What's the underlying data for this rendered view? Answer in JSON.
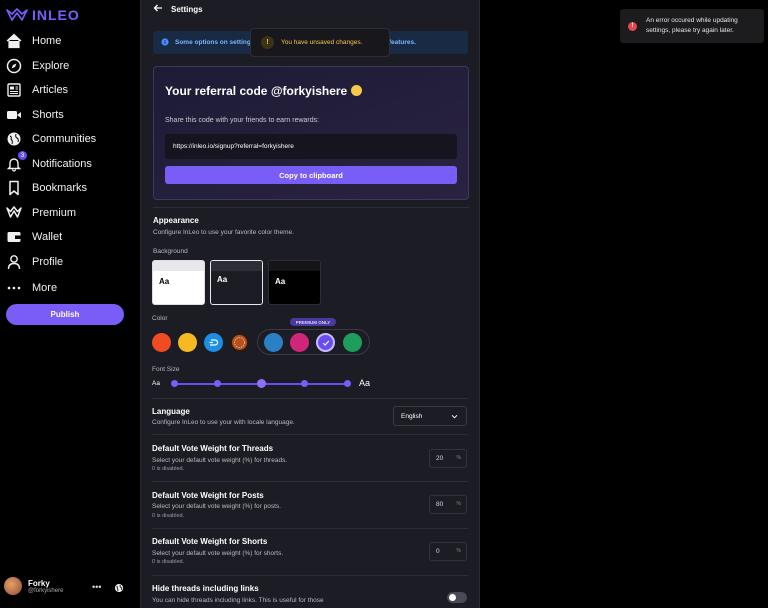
{
  "app": {
    "logo_text": "INLEO",
    "brand_color": "#7a5cf6"
  },
  "sidebar": {
    "items": [
      {
        "label": "Home",
        "icon": "home-icon"
      },
      {
        "label": "Explore",
        "icon": "compass-icon"
      },
      {
        "label": "Articles",
        "icon": "newspaper-icon"
      },
      {
        "label": "Shorts",
        "icon": "video-icon"
      },
      {
        "label": "Communities",
        "icon": "globe-icon"
      },
      {
        "label": "Notifications",
        "icon": "bell-icon",
        "badge": "3"
      },
      {
        "label": "Bookmarks",
        "icon": "bookmark-icon"
      },
      {
        "label": "Premium",
        "icon": "leo-logo-icon"
      },
      {
        "label": "Wallet",
        "icon": "wallet-icon"
      },
      {
        "label": "Profile",
        "icon": "user-icon"
      },
      {
        "label": "More",
        "icon": "more-dots-icon"
      }
    ],
    "publish_label": "Publish",
    "user": {
      "name": "Forky",
      "handle": "@forkyishere"
    }
  },
  "header": {
    "title": "Settings"
  },
  "info_banner": {
    "text": "Some options on settings are in development and we are developing features."
  },
  "toast_unsaved": {
    "text": "You have unsaved changes."
  },
  "toast_error": {
    "line1": "An error occured while updating",
    "line2": "settings, please try again later."
  },
  "referral": {
    "title": "Your referral code @forkyishere",
    "subtitle": "Share this code with your friends to earn rewards:",
    "link": "https://inleo.io/signup?referral=forkyishere",
    "copy_label": "Copy to clipboard"
  },
  "appearance": {
    "title": "Appearance",
    "description": "Configure InLeo to use your favorite color theme.",
    "background_label": "Background",
    "background_options": [
      {
        "sample": "Aa",
        "theme": "light"
      },
      {
        "sample": "Aa",
        "theme": "dim",
        "selected": true
      },
      {
        "sample": "Aa",
        "theme": "dark"
      }
    ],
    "color_label": "Color",
    "colors": [
      "#f04b23",
      "#f5b921",
      "#1a8fe3",
      "#b4531f",
      "#2b7fc4",
      "#d0267a",
      "#6b4cf0",
      "#1e9e5c"
    ],
    "premium_tag": "PREMIUM ONLY",
    "selected_color": "#6b4cf0",
    "font_size_label": "Font Size",
    "font_size_small": "Aa",
    "font_size_large": "Aa",
    "font_size_steps": 5,
    "font_size_selected_step": 3
  },
  "language": {
    "title": "Language",
    "description": "Configure InLeo to use your with locale language.",
    "value": "English"
  },
  "vote_threads": {
    "title": "Default Vote Weight for Threads",
    "description": "Select your default vote weight (%) for threads.",
    "note": "0 is disabled.",
    "value": "20",
    "unit": "%"
  },
  "vote_posts": {
    "title": "Default Vote Weight for Posts",
    "description": "Select your default vote weight (%) for posts.",
    "note": "0 is disabled.",
    "value": "80",
    "unit": "%"
  },
  "vote_shorts": {
    "title": "Default Vote Weight for Shorts",
    "description": "Select your default vote weight (%) for shorts.",
    "note": "0 is disabled.",
    "value": "0",
    "unit": "%"
  },
  "hide_threads": {
    "title": "Hide threads including links",
    "description": "You can hide threads including links. This is useful for those",
    "enabled": false
  }
}
